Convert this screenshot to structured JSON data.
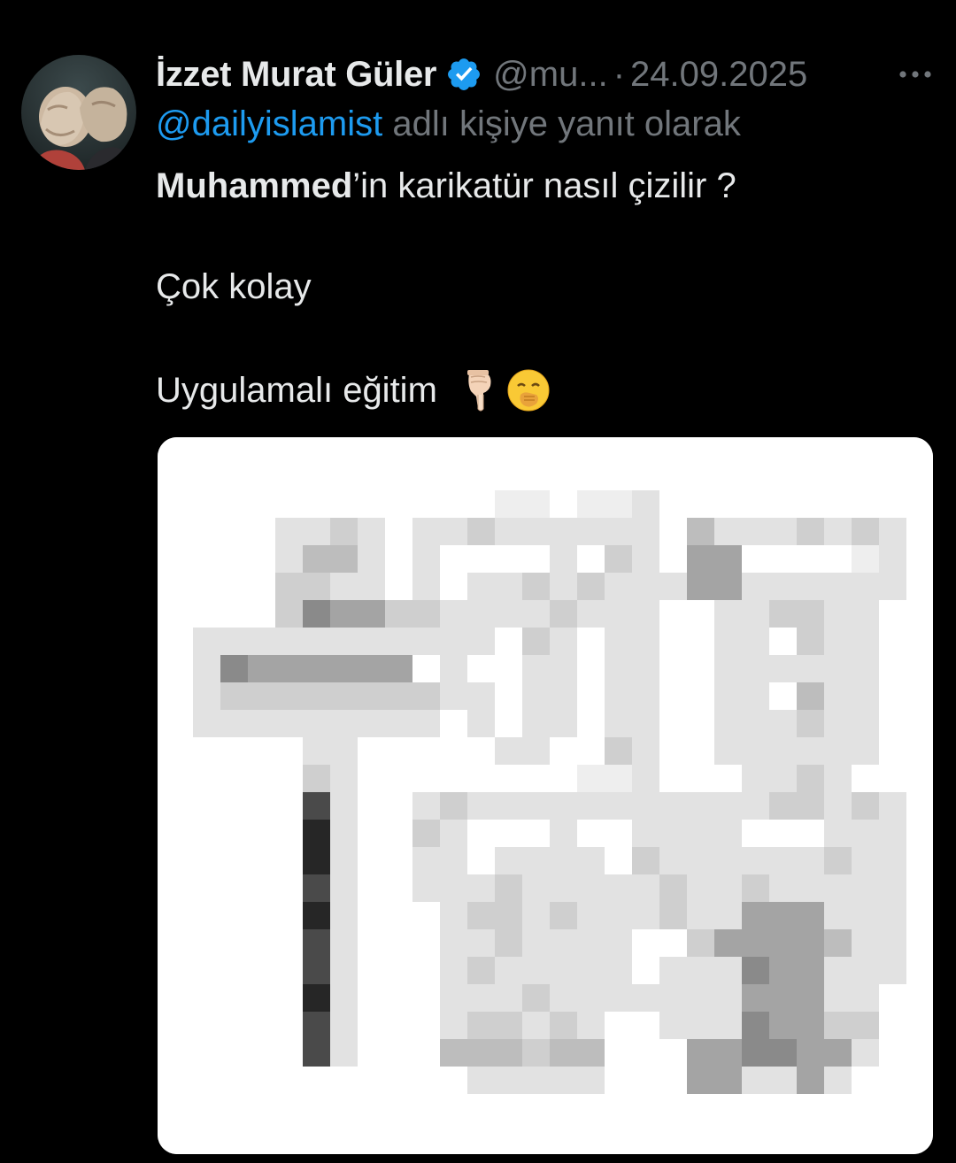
{
  "tweet": {
    "author_name": "İzzet Murat Güler",
    "handle": "@mu...",
    "separator": "·",
    "date": "24.09.2025",
    "reply_to_handle": "@dailyislamist",
    "reply_to_suffix": " adlı kişiye yanıt olarak",
    "text_bold": "Muhammed",
    "text_line1_rest": "’in karikatür nasıl çizilir ?",
    "text_line2": "Çok kolay",
    "text_line3": "Uygulamalı eğitim",
    "emojis": [
      "pointing-down-emoji",
      "face-with-hand-over-mouth-emoji"
    ],
    "media": {
      "kind": "pixelated-image",
      "background": "#ffffff"
    }
  },
  "colors": {
    "background": "#000000",
    "text_primary": "#e7e9ea",
    "text_secondary": "#71767b",
    "link": "#1d9bf0",
    "verified_badge": "#1d9bf0"
  },
  "icons": {
    "verified": "verified-badge-icon",
    "more": "more-options-icon"
  }
}
